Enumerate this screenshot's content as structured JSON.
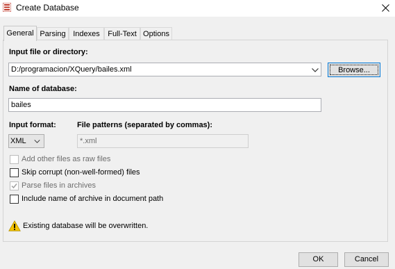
{
  "window": {
    "title": "Create Database",
    "close_icon": "close-icon"
  },
  "tabs": [
    {
      "label": "General",
      "active": true
    },
    {
      "label": "Parsing",
      "active": false
    },
    {
      "label": "Indexes",
      "active": false
    },
    {
      "label": "Full-Text",
      "active": false
    },
    {
      "label": "Options",
      "active": false
    }
  ],
  "general": {
    "input_label": "Input file or directory:",
    "input_value": "D:/programacion/XQuery/bailes.xml",
    "browse_label": "Browse...",
    "name_label": "Name of database:",
    "name_value": "bailes",
    "format_label": "Input format:",
    "format_value": "XML",
    "patterns_label": "File patterns (separated by commas):",
    "patterns_value": "*.xml",
    "options": [
      {
        "label": "Add other files as raw files",
        "checked": false,
        "enabled": false
      },
      {
        "label": "Skip corrupt (non-well-formed) files",
        "checked": false,
        "enabled": true
      },
      {
        "label": "Parse files in archives",
        "checked": true,
        "enabled": false
      },
      {
        "label": "Include name of archive in document path",
        "checked": false,
        "enabled": true
      }
    ],
    "warning": "Existing database will be overwritten.",
    "warning_icon": "warning-icon"
  },
  "footer": {
    "ok_label": "OK",
    "cancel_label": "Cancel"
  },
  "colors": {
    "focus": "#0078d7",
    "warning": "#f5c400"
  }
}
